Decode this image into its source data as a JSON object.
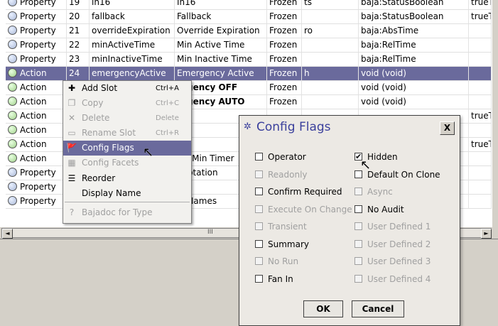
{
  "table": {
    "rows": [
      {
        "type": "Property",
        "idx": "19",
        "name": "in16",
        "display": "In16",
        "state": "Frozen",
        "flags": "ts",
        "datatype": "baja:StatusBoolean",
        "facets": "trueT"
      },
      {
        "type": "Property",
        "idx": "20",
        "name": "fallback",
        "display": "Fallback",
        "state": "Frozen",
        "flags": "",
        "datatype": "baja:StatusBoolean",
        "facets": "trueT"
      },
      {
        "type": "Property",
        "idx": "21",
        "name": "overrideExpiration",
        "display": "Override Expiration",
        "state": "Frozen",
        "flags": "ro",
        "datatype": "baja:AbsTime",
        "facets": ""
      },
      {
        "type": "Property",
        "idx": "22",
        "name": "minActiveTime",
        "display": "Min Active Time",
        "state": "Frozen",
        "flags": "",
        "datatype": "baja:RelTime",
        "facets": ""
      },
      {
        "type": "Property",
        "idx": "23",
        "name": "minInactiveTime",
        "display": "Min Inactive Time",
        "state": "Frozen",
        "flags": "",
        "datatype": "baja:RelTime",
        "facets": ""
      },
      {
        "type": "Action",
        "idx": "24",
        "name": "emergencyActive",
        "display": "Emergency Active",
        "state": "Frozen",
        "flags": "h",
        "datatype": "void (void)",
        "facets": ""
      },
      {
        "type": "Action",
        "idx": "",
        "name": "",
        "display": "ergency OFF",
        "state": "Frozen",
        "flags": "",
        "datatype": "void (void)",
        "facets": ""
      },
      {
        "type": "Action",
        "idx": "",
        "name": "",
        "display": "ergency AUTO",
        "state": "Frozen",
        "flags": "",
        "datatype": "void (void)",
        "facets": ""
      },
      {
        "type": "Action",
        "idx": "",
        "name": "",
        "display": "",
        "state": "",
        "flags": "",
        "datatype": "",
        "facets": "trueT"
      },
      {
        "type": "Action",
        "idx": "",
        "name": "",
        "display": "",
        "state": "",
        "flags": "",
        "datatype": "",
        "facets": ""
      },
      {
        "type": "Action",
        "idx": "",
        "name": "",
        "display": "",
        "state": "",
        "flags": "",
        "datatype": "",
        "facets": "trueT"
      },
      {
        "type": "Action",
        "idx": "",
        "name": "",
        "display": "cel Min Timer",
        "state": "",
        "flags": "",
        "datatype": "",
        "facets": ""
      },
      {
        "type": "Property",
        "idx": "",
        "name": "",
        "display": "nnotation",
        "state": "",
        "flags": "",
        "datatype": "",
        "facets": ""
      },
      {
        "type": "Property",
        "idx": "",
        "name": "",
        "display": "",
        "state": "",
        "flags": "",
        "datatype": "",
        "facets": ""
      },
      {
        "type": "Property",
        "idx": "",
        "name": "",
        "display": "ayNames",
        "state": "",
        "flags": "",
        "datatype": "",
        "facets": ""
      }
    ]
  },
  "scrollbar": {
    "thumb_mark": "III",
    "left_arrow": "◄",
    "right_arrow": "►"
  },
  "context_menu": {
    "items": [
      {
        "label": "Add Slot",
        "shortcut": "Ctrl+A",
        "icon": "add-slot-icon",
        "glyph": "✚"
      },
      {
        "label": "Copy",
        "shortcut": "Ctrl+C",
        "icon": "copy-icon",
        "glyph": "❐"
      },
      {
        "label": "Delete",
        "shortcut": "Delete",
        "icon": "delete-icon",
        "glyph": "✕"
      },
      {
        "label": "Rename Slot",
        "shortcut": "Ctrl+R",
        "icon": "rename-icon",
        "glyph": "▭"
      },
      {
        "label": "Config Flags",
        "shortcut": "",
        "icon": "config-flags-icon",
        "glyph": "🚩"
      },
      {
        "label": "Config Facets",
        "shortcut": "",
        "icon": "config-facets-icon",
        "glyph": "▦"
      },
      {
        "label": "Reorder",
        "shortcut": "",
        "icon": "reorder-icon",
        "glyph": "☰"
      },
      {
        "label": "Display Name",
        "shortcut": "",
        "icon": "",
        "glyph": ""
      },
      {
        "label": "Bajadoc for Type",
        "shortcut": "",
        "icon": "bajadoc-icon",
        "glyph": "?"
      }
    ]
  },
  "dialog": {
    "title": "Config Flags",
    "close_label": "X",
    "flags_left": [
      {
        "label": "Operator",
        "checked": false,
        "enabled": true
      },
      {
        "label": "Readonly",
        "checked": false,
        "enabled": false
      },
      {
        "label": "Confirm Required",
        "checked": false,
        "enabled": true
      },
      {
        "label": "Execute On Change",
        "checked": false,
        "enabled": false
      },
      {
        "label": "Transient",
        "checked": false,
        "enabled": false
      },
      {
        "label": "Summary",
        "checked": false,
        "enabled": true
      },
      {
        "label": "No Run",
        "checked": false,
        "enabled": false
      },
      {
        "label": "Fan In",
        "checked": false,
        "enabled": true
      }
    ],
    "flags_right": [
      {
        "label": "Hidden",
        "checked": true,
        "enabled": true
      },
      {
        "label": "Default On Clone",
        "checked": false,
        "enabled": true
      },
      {
        "label": "Async",
        "checked": false,
        "enabled": false
      },
      {
        "label": "No Audit",
        "checked": false,
        "enabled": true
      },
      {
        "label": "User Defined 1",
        "checked": false,
        "enabled": false
      },
      {
        "label": "User Defined 2",
        "checked": false,
        "enabled": false
      },
      {
        "label": "User Defined 3",
        "checked": false,
        "enabled": false
      },
      {
        "label": "User Defined 4",
        "checked": false,
        "enabled": false
      }
    ],
    "ok_label": "OK",
    "cancel_label": "Cancel"
  },
  "colors": {
    "selection": "#6a6a9c",
    "title_text": "#3a3f9c"
  }
}
